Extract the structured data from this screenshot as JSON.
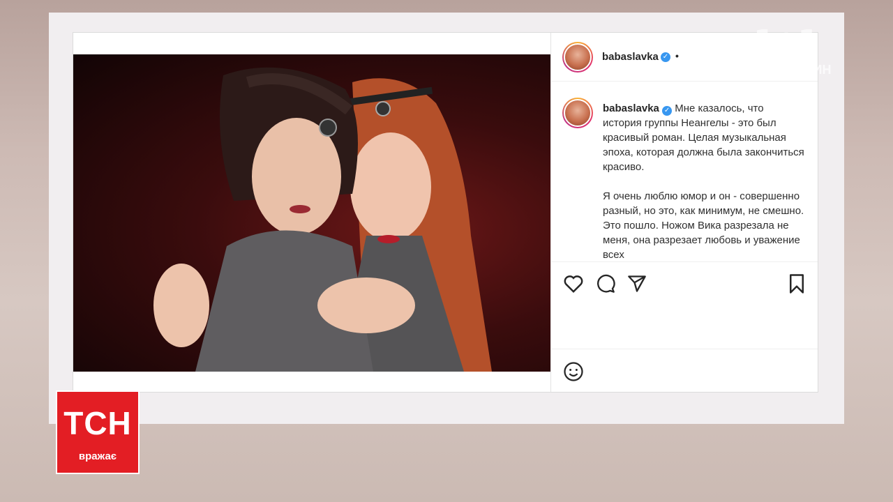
{
  "post": {
    "username": "babaslavka",
    "header_separator": "•",
    "verified_glyph": "✓",
    "caption_paragraphs": [
      "Мне казалось, что история группы Неангелы - это был красивый роман. Целая музыкальная эпоха, которая должна была закончиться красиво.",
      "Я очень люблю юмор и он - совершенно разный, но это, как минимум, не смешно. Это пошло. Ножом Вика разрезала не меня, она разрезает любовь и уважение всех"
    ],
    "icons": [
      "heart-icon",
      "comment-icon",
      "share-icon",
      "bookmark-icon",
      "emoji-icon"
    ]
  },
  "channel_logo": {
    "text": "1+1",
    "slogan": "ТИ НЕ ОДИН"
  },
  "tsn_logo": {
    "title": "ТСН",
    "subtitle": "вражає"
  },
  "colors": {
    "tsn_red": "#e31e24",
    "verified_blue": "#3897f0"
  }
}
